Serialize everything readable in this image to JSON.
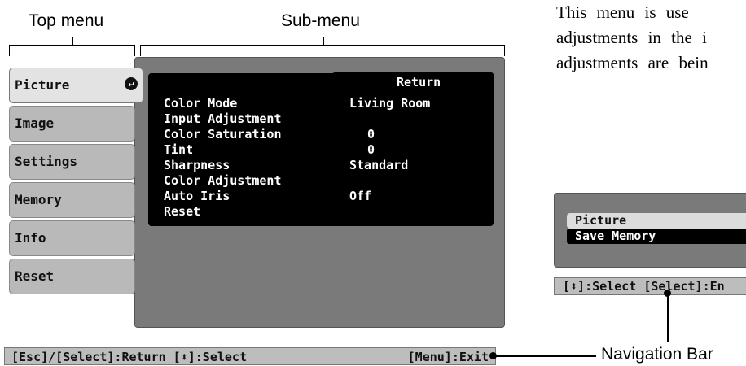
{
  "callouts": {
    "top_menu": "Top menu",
    "sub_menu": "Sub-menu",
    "navigation_bar": "Navigation Bar"
  },
  "body_text": {
    "line1": "This menu is use",
    "line2": "adjustments in the i",
    "line3": "adjustments are bein"
  },
  "top_menu": {
    "items": [
      {
        "label": "Picture",
        "selected": true
      },
      {
        "label": "Image"
      },
      {
        "label": "Settings"
      },
      {
        "label": "Memory"
      },
      {
        "label": "Info"
      },
      {
        "label": "Reset"
      }
    ],
    "enter_icon": "↵"
  },
  "sub_menu": {
    "return_label": "Return",
    "rows": [
      {
        "label": "Color Mode",
        "value": "Living Room"
      },
      {
        "label": "Input Adjustment",
        "value": ""
      },
      {
        "label": "Color Saturation",
        "value": "0"
      },
      {
        "label": "Tint",
        "value": "0"
      },
      {
        "label": "Sharpness",
        "value": "Standard"
      },
      {
        "label": "Color Adjustment",
        "value": ""
      },
      {
        "label": "Auto Iris",
        "value": "Off"
      },
      {
        "label": "Reset",
        "value": ""
      }
    ]
  },
  "nav_bar": {
    "left": "[Esc]/[Select]:Return [⬍]:Select",
    "right": "[Menu]:Exit"
  },
  "small_menu": {
    "picture_label": "Picture",
    "save_memory_label": "Save Memory",
    "nav_text": "[⬍]:Select [Select]:En"
  },
  "colors": {
    "panel": "#7a7a7a",
    "submenu_bg": "#000000",
    "tab": "#b9b9b9",
    "tab_selected": "#e3e3e3",
    "nav_bar": "#bdbdbd"
  }
}
